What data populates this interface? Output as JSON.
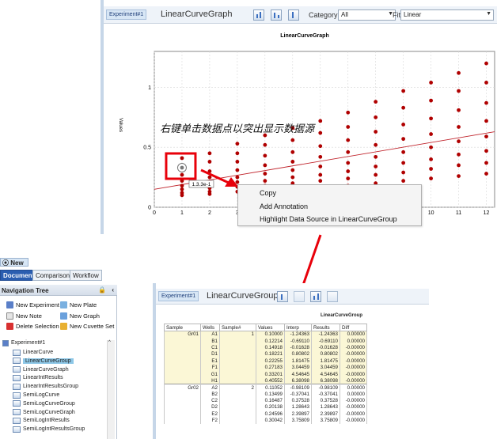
{
  "top_window": {
    "tab": "Experiment#1",
    "title": "LinearCurveGraph",
    "category_label": "Category",
    "category_value": "All",
    "fit_label": "Fit",
    "fit_value": "Linear",
    "annotation_text": "右键单击数据点以突出显示数据源",
    "tooltip": "1.3.3e-1"
  },
  "chart_data": {
    "type": "scatter",
    "title": "LinearCurveGraph",
    "ylabel": "Values",
    "xlabel": "",
    "xlim": [
      0,
      12.3
    ],
    "ylim": [
      0,
      1.3
    ],
    "x_ticks": [
      0,
      1,
      2,
      3,
      4,
      5,
      6,
      7,
      8,
      9,
      10,
      11,
      12
    ],
    "y_ticks": [
      0,
      0.5,
      1
    ],
    "y_tick_labels": [
      "0",
      "0.5",
      "1"
    ],
    "grid": true,
    "point_color": "#b00000",
    "fit_color": "#c0242c",
    "fit_line": {
      "x": [
        0,
        12.3
      ],
      "y": [
        0.15,
        0.63
      ]
    },
    "highlighted_point": {
      "x": 1,
      "y": 0.33
    },
    "points": [
      {
        "x": 1,
        "y": 0.1
      },
      {
        "x": 1,
        "y": 0.12
      },
      {
        "x": 1,
        "y": 0.15
      },
      {
        "x": 1,
        "y": 0.18
      },
      {
        "x": 1,
        "y": 0.22
      },
      {
        "x": 1,
        "y": 0.27
      },
      {
        "x": 1,
        "y": 0.33
      },
      {
        "x": 1,
        "y": 0.41
      },
      {
        "x": 2,
        "y": 0.11
      },
      {
        "x": 2,
        "y": 0.13
      },
      {
        "x": 2,
        "y": 0.16
      },
      {
        "x": 2,
        "y": 0.2
      },
      {
        "x": 2,
        "y": 0.25
      },
      {
        "x": 2,
        "y": 0.3
      },
      {
        "x": 2,
        "y": 0.38
      },
      {
        "x": 2,
        "y": 0.45
      },
      {
        "x": 3,
        "y": 0.13
      },
      {
        "x": 3,
        "y": 0.17
      },
      {
        "x": 3,
        "y": 0.21
      },
      {
        "x": 3,
        "y": 0.25
      },
      {
        "x": 3,
        "y": 0.31
      },
      {
        "x": 3,
        "y": 0.38
      },
      {
        "x": 3,
        "y": 0.45
      },
      {
        "x": 3,
        "y": 0.53
      },
      {
        "x": 4,
        "y": 0.14
      },
      {
        "x": 4,
        "y": 0.18
      },
      {
        "x": 4,
        "y": 0.22
      },
      {
        "x": 4,
        "y": 0.28
      },
      {
        "x": 4,
        "y": 0.35
      },
      {
        "x": 4,
        "y": 0.43
      },
      {
        "x": 4,
        "y": 0.52
      },
      {
        "x": 4,
        "y": 0.6
      },
      {
        "x": 5,
        "y": 0.15
      },
      {
        "x": 5,
        "y": 0.2
      },
      {
        "x": 5,
        "y": 0.25
      },
      {
        "x": 5,
        "y": 0.31
      },
      {
        "x": 5,
        "y": 0.38
      },
      {
        "x": 5,
        "y": 0.46
      },
      {
        "x": 5,
        "y": 0.56
      },
      {
        "x": 5,
        "y": 0.66
      },
      {
        "x": 6,
        "y": 0.17
      },
      {
        "x": 6,
        "y": 0.22
      },
      {
        "x": 6,
        "y": 0.27
      },
      {
        "x": 6,
        "y": 0.34
      },
      {
        "x": 6,
        "y": 0.42
      },
      {
        "x": 6,
        "y": 0.51
      },
      {
        "x": 6,
        "y": 0.62
      },
      {
        "x": 6,
        "y": 0.72
      },
      {
        "x": 7,
        "y": 0.18
      },
      {
        "x": 7,
        "y": 0.24
      },
      {
        "x": 7,
        "y": 0.3
      },
      {
        "x": 7,
        "y": 0.37
      },
      {
        "x": 7,
        "y": 0.46
      },
      {
        "x": 7,
        "y": 0.56
      },
      {
        "x": 7,
        "y": 0.67
      },
      {
        "x": 7,
        "y": 0.79
      },
      {
        "x": 8,
        "y": 0.2
      },
      {
        "x": 8,
        "y": 0.27
      },
      {
        "x": 8,
        "y": 0.34
      },
      {
        "x": 8,
        "y": 0.42
      },
      {
        "x": 8,
        "y": 0.52
      },
      {
        "x": 8,
        "y": 0.63
      },
      {
        "x": 8,
        "y": 0.75
      },
      {
        "x": 8,
        "y": 0.88
      },
      {
        "x": 9,
        "y": 0.22
      },
      {
        "x": 9,
        "y": 0.29
      },
      {
        "x": 9,
        "y": 0.37
      },
      {
        "x": 9,
        "y": 0.46
      },
      {
        "x": 9,
        "y": 0.57
      },
      {
        "x": 9,
        "y": 0.69
      },
      {
        "x": 9,
        "y": 0.83
      },
      {
        "x": 9,
        "y": 0.97
      },
      {
        "x": 10,
        "y": 0.24
      },
      {
        "x": 10,
        "y": 0.32
      },
      {
        "x": 10,
        "y": 0.4
      },
      {
        "x": 10,
        "y": 0.5
      },
      {
        "x": 10,
        "y": 0.61
      },
      {
        "x": 10,
        "y": 0.74
      },
      {
        "x": 10,
        "y": 0.89
      },
      {
        "x": 10,
        "y": 1.04
      },
      {
        "x": 11,
        "y": 0.26
      },
      {
        "x": 11,
        "y": 0.35
      },
      {
        "x": 11,
        "y": 0.44
      },
      {
        "x": 11,
        "y": 0.55
      },
      {
        "x": 11,
        "y": 0.67
      },
      {
        "x": 11,
        "y": 0.81
      },
      {
        "x": 11,
        "y": 0.97
      },
      {
        "x": 11,
        "y": 1.12
      },
      {
        "x": 12,
        "y": 0.28
      },
      {
        "x": 12,
        "y": 0.37
      },
      {
        "x": 12,
        "y": 0.47
      },
      {
        "x": 12,
        "y": 0.59
      },
      {
        "x": 12,
        "y": 0.72
      },
      {
        "x": 12,
        "y": 0.87
      },
      {
        "x": 12,
        "y": 1.04
      },
      {
        "x": 12,
        "y": 1.2
      }
    ]
  },
  "context_menu": {
    "items": [
      "Copy",
      "Add Annotation",
      "Highlight Data Source in LinearCurveGroup"
    ]
  },
  "app": {
    "tab": "New",
    "mode_tabs": [
      "Document",
      "Comparison",
      "Workflow"
    ],
    "active_mode": "Document"
  },
  "nav": {
    "title": "Navigation Tree",
    "buttons": [
      "New Experiment",
      "New Plate",
      "New Note",
      "New Graph",
      "Delete Selection",
      "New Cuvette Set"
    ],
    "tree_root": "Experiment#1",
    "tree_items": [
      "LinearCurve",
      "LinearCurveGroup",
      "LinearCurveGraph",
      "LinearIntResults",
      "LinearIntResultsGroup",
      "SemiLogCurve",
      "SemiLogCurveGroup",
      "SemiLogCurveGraph",
      "SemiLogIntResults",
      "SemiLogIntResultsGroup"
    ],
    "selected": "LinearCurveGroup"
  },
  "group_window": {
    "tab": "Experiment#1",
    "title": "LinearCurveGroup",
    "table_title": "LinearCurveGroup",
    "columns": [
      "Sample",
      "Wells",
      "Sample#",
      "Values",
      "Interp",
      "Results",
      "Diff"
    ],
    "rows": [
      [
        "Gr01",
        "A1",
        "1",
        "0.10000",
        "-1.24363",
        "-1.24363",
        "0.00000"
      ],
      [
        "",
        "B1",
        "",
        "0.12214",
        "-0.69110",
        "-0.69110",
        "0.00000"
      ],
      [
        "",
        "C1",
        "",
        "0.14918",
        "-0.01628",
        "-0.01628",
        "-0.00000"
      ],
      [
        "",
        "D1",
        "",
        "0.18221",
        "0.80802",
        "0.80802",
        "-0.00000"
      ],
      [
        "",
        "E1",
        "",
        "0.22255",
        "1.81475",
        "1.81475",
        "-0.00000"
      ],
      [
        "",
        "F1",
        "",
        "0.27183",
        "3.04459",
        "3.04459",
        "-0.00000"
      ],
      [
        "",
        "G1",
        "",
        "0.33201",
        "4.54645",
        "4.54645",
        "-0.00000"
      ],
      [
        "",
        "H1",
        "",
        "0.40552",
        "6.38098",
        "6.38098",
        "-0.00000"
      ],
      [
        "Gr02",
        "A2",
        "2",
        "0.11052",
        "-0.98109",
        "-0.98109",
        "0.00000"
      ],
      [
        "",
        "B2",
        "",
        "0.13499",
        "-0.37041",
        "-0.37041",
        "0.00000"
      ],
      [
        "",
        "C2",
        "",
        "0.16487",
        "0.37528",
        "0.37528",
        "-0.00000"
      ],
      [
        "",
        "D2",
        "",
        "0.20138",
        "1.28643",
        "1.28643",
        "-0.00000"
      ],
      [
        "",
        "E2",
        "",
        "0.24596",
        "2.39897",
        "2.39897",
        "-0.00000"
      ],
      [
        "",
        "F2",
        "",
        "0.30042",
        "3.75809",
        "3.75809",
        "-0.00000"
      ]
    ]
  }
}
